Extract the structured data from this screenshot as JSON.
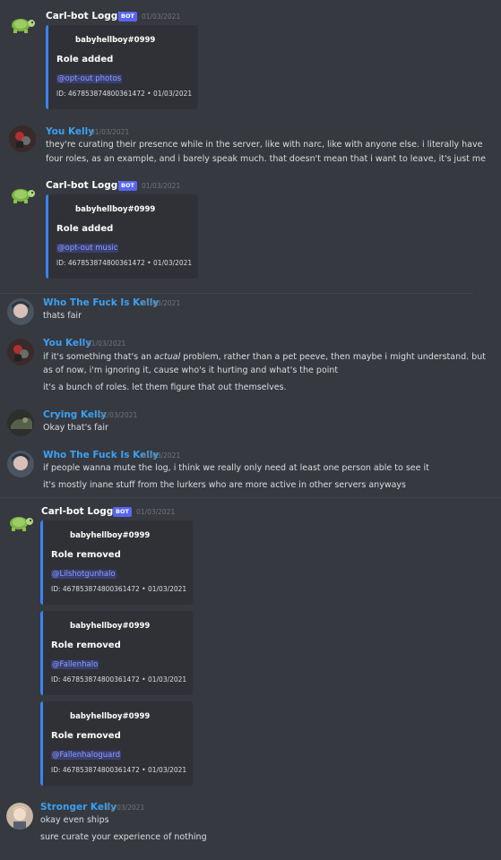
{
  "messages": [
    {
      "user": "Carl-bot Logging",
      "badge": "BOT",
      "time": "01/03/2021",
      "embed": {
        "author": "babyhellboy#0999",
        "title": "Role added",
        "mention": "@opt-out photos",
        "footer": "ID: 467853874800361472 • 01/03/2021"
      }
    },
    {
      "user": "You Kelly",
      "time": "01/03/2021",
      "lines": [
        "they're curating their presence while in the server, like with narc, like with anyone else. i literally have",
        "four roles, as an example, and i barely speak much. that doesn't mean that i want to leave, it's just me"
      ]
    },
    {
      "user": "Carl-bot Logging",
      "badge": "BOT",
      "time": "01/03/2021",
      "embed": {
        "author": "babyhellboy#0999",
        "title": "Role added",
        "mention": "@opt-out music",
        "footer": "ID: 467853874800361472 • 01/03/2021"
      }
    },
    {
      "user": "Who The Fuck Is Kelly",
      "time": "01/03/2021",
      "lines": [
        "thats fair"
      ]
    },
    {
      "user": "You Kelly",
      "time": "01/03/2021",
      "line1_pre": "if it's something that's an ",
      "line1_em": "actual",
      "line1_post": " problem, rather than a pet peeve, then maybe i might understand. but",
      "lines": [
        "as of now, i'm ignoring it, cause who's it hurting and what's the point",
        "it's a bunch of roles. let them figure that out themselves."
      ]
    },
    {
      "user": "Crying Kelly",
      "time": "01/03/2021",
      "lines": [
        "Okay that's fair"
      ]
    },
    {
      "user": "Who The Fuck Is Kelly",
      "time": "01/03/2021",
      "lines": [
        "if people wanna mute the log, i think we really only need at least one person able to see it",
        "it's mostly inane stuff from the lurkers who are more active in other servers anyways"
      ]
    },
    {
      "user": "Carl-bot Logging",
      "badge": "BOT",
      "time": "01/03/2021",
      "embeds": [
        {
          "author": "babyhellboy#0999",
          "title": "Role removed",
          "mention": "@Lilshotgunhalo",
          "footer": "ID: 467853874800361472 • 01/03/2021"
        },
        {
          "author": "babyhellboy#0999",
          "title": "Role removed",
          "mention": "@Fallenhalo",
          "footer": "ID: 467853874800361472 • 01/03/2021"
        },
        {
          "author": "babyhellboy#0999",
          "title": "Role removed",
          "mention": "@Fallenhaloguard",
          "footer": "ID: 467853874800361472 • 01/03/2021"
        }
      ]
    },
    {
      "user": "Stronger Kelly",
      "time": "01/03/2021",
      "lines": [
        "okay even ships",
        "sure curate your experience of nothing"
      ]
    }
  ],
  "colors": {
    "bot_name": "#ffffff",
    "user_name": "#3ba1f5",
    "background": "#36393f",
    "embed_bg": "#2f3136",
    "embed_border": "#3b82f6"
  }
}
